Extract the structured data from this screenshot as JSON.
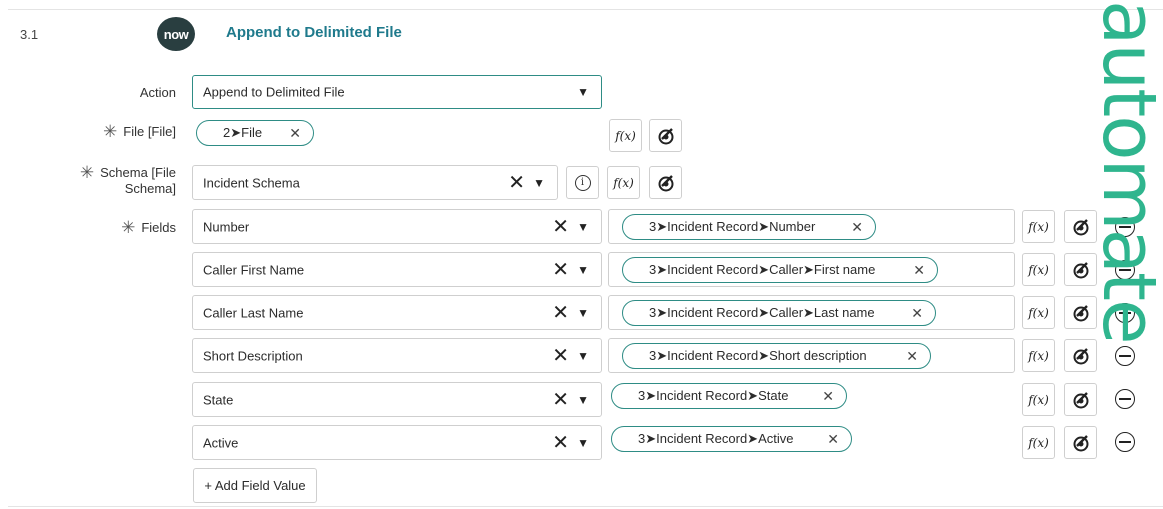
{
  "step": {
    "number": "3.1",
    "logo_text": "now",
    "title": "Append to Delimited File"
  },
  "form": {
    "action_label": "Action",
    "action_value": "Append to Delimited File",
    "file_label": "File [File]",
    "file_value": "2➤File",
    "schema_label_line1": "Schema [File",
    "schema_label_line2": "Schema]",
    "schema_value": "Incident Schema",
    "fields_label": "Fields",
    "fields": [
      {
        "name": "Number",
        "value": "3➤Incident Record➤Number"
      },
      {
        "name": "Caller First Name",
        "value": "3➤Incident Record➤Caller➤First name"
      },
      {
        "name": "Caller Last Name",
        "value": "3➤Incident Record➤Caller➤Last name"
      },
      {
        "name": "Short Description",
        "value": "3➤Incident Record➤Short description"
      },
      {
        "name": "State",
        "value": "3➤Incident Record➤State"
      },
      {
        "name": "Active",
        "value": "3➤Incident Record➤Active"
      }
    ],
    "add_field_label": "+ Add Field Value"
  },
  "glyphs": {
    "fx": "f(x)",
    "info": "i",
    "clear": "✕",
    "caret": "▼",
    "pill_clear": "✕",
    "required": "✳"
  },
  "watermark": "automate",
  "colors": {
    "accent": "#2e8c85",
    "title": "#1f7a8c",
    "logo_bg": "#293e40",
    "watermark": "#2fb58e"
  }
}
